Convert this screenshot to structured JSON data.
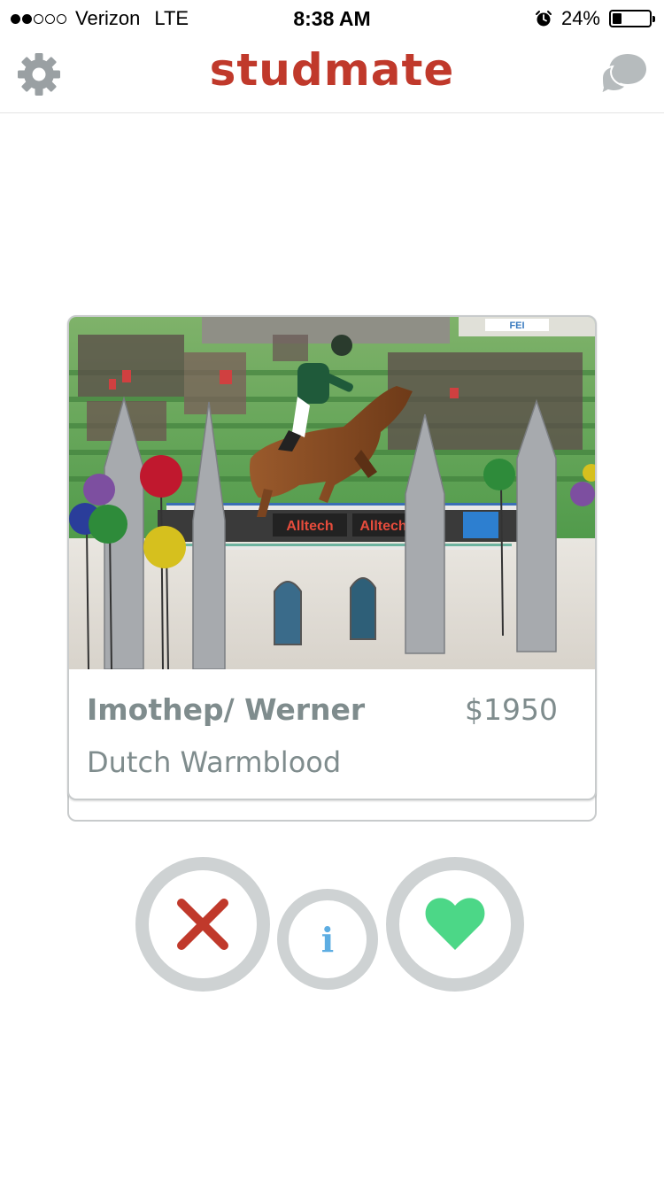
{
  "status_bar": {
    "carrier": "Verizon",
    "network": "LTE",
    "time": "8:38 AM",
    "battery": "24%",
    "battery_level": 0.24,
    "signal_bars_filled": 2,
    "signal_bars_total": 5
  },
  "nav": {
    "title": "studmate",
    "settings_icon": "gear-icon",
    "messages_icon": "chat-bubbles-icon"
  },
  "card": {
    "name": "Imothep/ Werner",
    "price": "$1950",
    "breed": "Dutch Warmblood",
    "photo_sign_text": "Alltech",
    "photo_banner_text": "FEI"
  },
  "actions": {
    "dislike_icon": "close-icon",
    "info_label": "i",
    "like_icon": "heart-icon"
  },
  "colors": {
    "brand": "#c0392b",
    "text_gray": "#7f8c8d",
    "ring_gray": "#ced2d3",
    "dislike_red": "#c0392b",
    "info_blue": "#5dade2",
    "like_green": "#4cd787"
  }
}
